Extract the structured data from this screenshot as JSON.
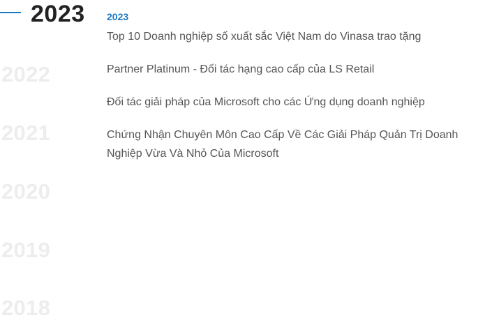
{
  "timeline": {
    "active_year": "2023",
    "years": [
      "2022",
      "2021",
      "2020",
      "2019",
      "2018"
    ]
  },
  "content": {
    "year_heading": "2023",
    "awards": [
      "Top 10 Doanh nghiệp số xuất sắc Việt Nam do Vinasa trao tặng",
      "Partner Platinum - Đối tác hạng cao cấp của LS Retail",
      "Đối tác giải pháp của Microsoft cho các Ứng dụng doanh nghiệp",
      "Chứng Nhận Chuyên Môn Cao Cấp Về Các Giải Pháp Quản Trị Doanh Nghiệp Vừa Và Nhỏ Của Microsoft"
    ]
  },
  "colors": {
    "accent": "#1b78c2",
    "active_year_text": "#222222",
    "inactive_year_text": "#ededed",
    "body_text": "#555555"
  }
}
